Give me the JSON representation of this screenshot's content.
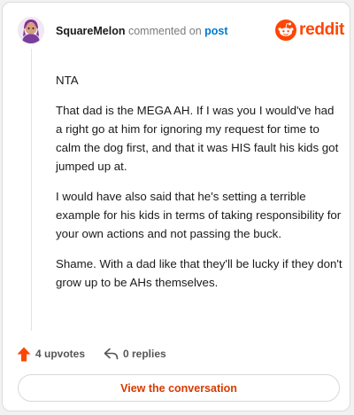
{
  "header": {
    "username": "SquareMelon",
    "action_text": "commented on",
    "post_link": "post"
  },
  "brand": {
    "wordmark": "reddit",
    "color": "#ff4500"
  },
  "comment": {
    "paragraphs": [
      "NTA",
      "That dad is the MEGA AH. If I was you I would've had a right go at him for ignoring my request for time to calm the dog first, and that it was HIS fault his kids got jumped up at.",
      "I would have also said that he's setting a terrible example for his kids in terms of taking responsibility for your own actions and not passing the buck.",
      "Shame. With a dad like that they'll be lucky if they don't grow up to be AHs themselves."
    ]
  },
  "actions": {
    "upvotes": "4 upvotes",
    "replies": "0 replies"
  },
  "footer": {
    "view_label": "View the conversation",
    "accent_color": "#d93a00"
  },
  "icons": [
    "avatar",
    "reddit-logo-icon",
    "upvote-arrow-icon",
    "reply-icon"
  ]
}
